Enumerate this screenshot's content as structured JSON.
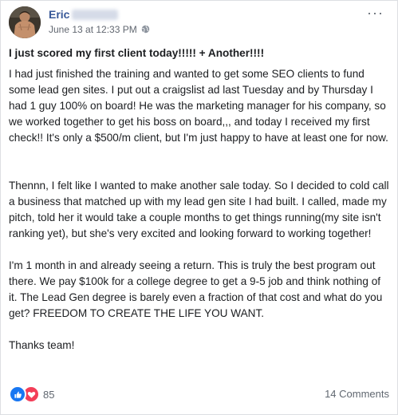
{
  "post": {
    "author_first_name": "Eric",
    "timestamp": "June 13 at 12:33 PM",
    "options_label": "···",
    "headline": "I just scored my first client today!!!!!  + Another!!!!",
    "paragraphs": [
      "I had just finished the training and wanted to get some SEO clients to fund some lead gen sites. I put out a craigslist ad last Tuesday and by Thursday I had 1 guy  100% on board! He was the marketing manager for his company, so we worked together to get his boss on board,,, and today I received my first check!! It's only a $500/m client, but I'm just happy to have at least one for now.",
      "Thennn, I felt like I wanted to make another sale today. So I decided to cold call a business that matched up with my lead gen site I had built. I called, made my pitch, told her it would take a couple months to get things running(my site isn't ranking yet), but she's very excited and looking forward to working together!",
      "I'm 1 month in and already seeing a return. This is truly the best program out there. We pay $100k for a college degree to get a 9-5 job and think nothing of it. The Lead Gen degree is barely even a fraction of that cost and what do you get? FREEDOM TO CREATE THE LIFE YOU WANT.",
      "Thanks team!"
    ]
  },
  "footer": {
    "reaction_count": "85",
    "comments_label": "14 Comments"
  },
  "icons": {
    "privacy": "globe-icon",
    "reaction_like": "thumbs-up-icon",
    "reaction_love": "heart-icon"
  },
  "colors": {
    "author_link": "#385898",
    "like_blue": "#1877f2",
    "love_red": "#f33e58",
    "meta_gray": "#616770"
  }
}
